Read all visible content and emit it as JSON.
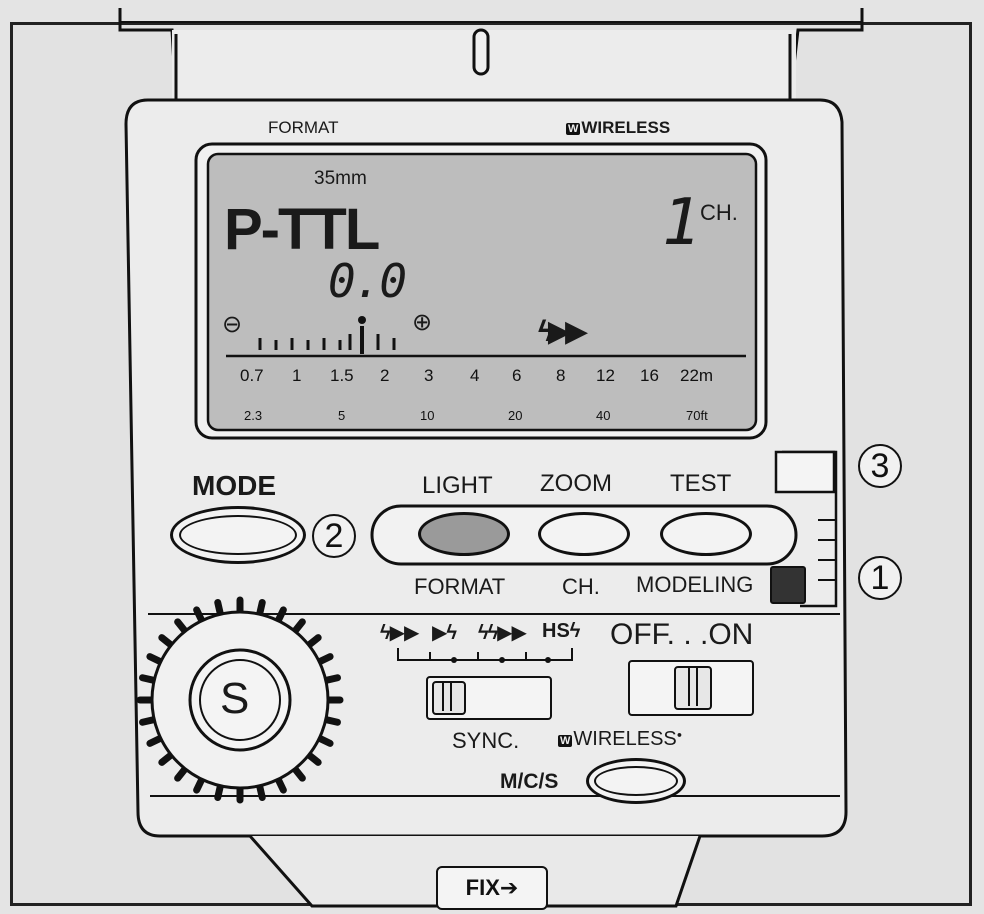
{
  "top": {
    "wireless_label": "WIRELESS",
    "format_label": "FORMAT"
  },
  "lcd": {
    "focal_length": "35mm",
    "mode": "P-TTL",
    "channel_num": "1",
    "channel_unit": "CH.",
    "exposure_comp": "0.0",
    "minus_sign": "⊖",
    "plus_sign": "⊕",
    "flash_indicator": "ϟ▶▶",
    "meter_scale": [
      "0.7",
      "1",
      "1.5",
      "2",
      "3",
      "4",
      "6",
      "8",
      "12",
      "16",
      "22m"
    ],
    "feet_scale": [
      "2.3",
      "5",
      "10",
      "20",
      "40",
      "70ft"
    ]
  },
  "buttons": {
    "mode_label": "MODE",
    "light_label": "LIGHT",
    "zoom_label": "ZOOM",
    "test_label": "TEST",
    "format_sub": "FORMAT",
    "ch_sub": "CH.",
    "modeling_sub": "MODELING"
  },
  "callouts": {
    "c1": "1",
    "c2": "2",
    "c3": "3"
  },
  "sync": {
    "modes": [
      "ϟ▶▶",
      "▶ϟ",
      "ϟϟ▶▶",
      "HSϟ"
    ],
    "label": "SYNC."
  },
  "power": {
    "label": "OFF. . .ON"
  },
  "dial": {
    "label": "S"
  },
  "wireless_bottom": {
    "label": "WIRELESS",
    "sup": "●"
  },
  "mcs": {
    "label": "M/C/S"
  },
  "fix": {
    "label": "FIX➔"
  },
  "colors": {
    "lcd_bg": "#bdbdbd",
    "light_button": "#9a9a9a",
    "ink": "#111111",
    "body": "#e9e9e9"
  }
}
